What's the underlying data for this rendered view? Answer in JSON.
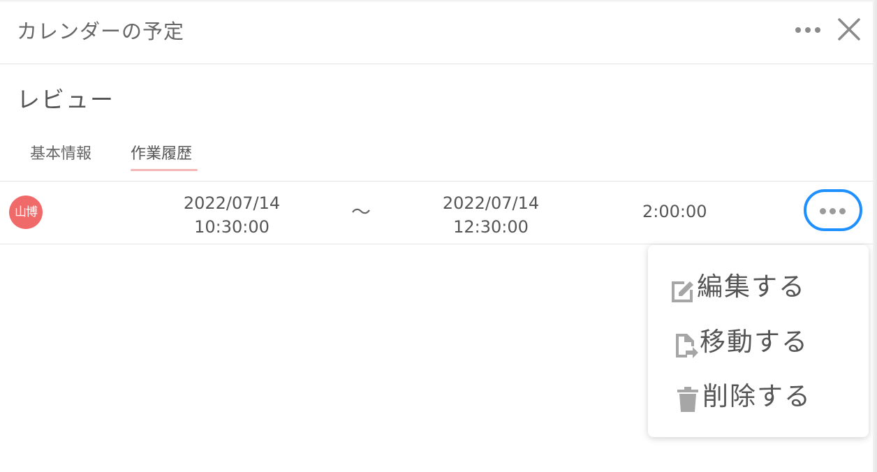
{
  "header": {
    "title": "カレンダーの予定",
    "more_icon": "ellipsis-icon",
    "close_icon": "close-icon"
  },
  "event": {
    "title": "レビュー"
  },
  "tabs": [
    {
      "label": "基本情報",
      "active": false
    },
    {
      "label": "作業履歴",
      "active": true
    }
  ],
  "history": [
    {
      "avatar_text": "山博",
      "avatar_color": "#f16a6a",
      "start_date": "2022/07/14",
      "start_time": "10:30:00",
      "separator": "〜",
      "end_date": "2022/07/14",
      "end_time": "12:30:00",
      "duration": "2:00:00"
    }
  ],
  "context_menu": {
    "items": [
      {
        "label": "編集する",
        "icon": "edit-icon"
      },
      {
        "label": "移動する",
        "icon": "move-file-icon"
      },
      {
        "label": "削除する",
        "icon": "trash-icon"
      }
    ]
  },
  "colors": {
    "accent_focus": "#1e90ff",
    "tab_underline": "#f2b6b6",
    "avatar": "#f16a6a"
  }
}
